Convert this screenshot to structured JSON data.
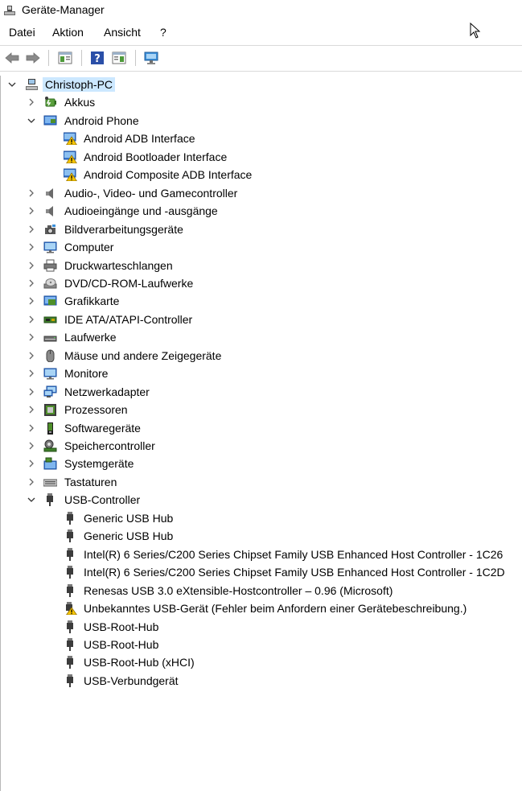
{
  "window": {
    "title": "Geräte-Manager"
  },
  "menu": [
    "Datei",
    "Aktion",
    "Ansicht",
    "?"
  ],
  "toolbar": [
    "back-icon",
    "forward-icon",
    "properties-view-icon",
    "help-icon",
    "action-view-icon",
    "scan-hardware-icon"
  ],
  "tree": {
    "root": "Christoph-PC",
    "items": [
      {
        "label": "Akkus",
        "icon": "battery-icon",
        "expanded": false
      },
      {
        "label": "Android Phone",
        "icon": "android-phone-icon",
        "expanded": true,
        "children": [
          {
            "label": "Android ADB Interface",
            "icon": "warning-device-icon"
          },
          {
            "label": "Android Bootloader Interface",
            "icon": "warning-device-icon"
          },
          {
            "label": "Android Composite ADB Interface",
            "icon": "warning-device-icon"
          }
        ]
      },
      {
        "label": "Audio-, Video- und Gamecontroller",
        "icon": "speaker-icon",
        "expanded": false
      },
      {
        "label": "Audioeingänge und -ausgänge",
        "icon": "speaker-icon",
        "expanded": false
      },
      {
        "label": "Bildverarbeitungsgeräte",
        "icon": "camera-icon",
        "expanded": false
      },
      {
        "label": "Computer",
        "icon": "computer-icon",
        "expanded": false
      },
      {
        "label": "Druckwarteschlangen",
        "icon": "printer-icon",
        "expanded": false
      },
      {
        "label": "DVD/CD-ROM-Laufwerke",
        "icon": "optical-drive-icon",
        "expanded": false
      },
      {
        "label": "Grafikkarte",
        "icon": "display-adapter-icon",
        "expanded": false
      },
      {
        "label": "IDE ATA/ATAPI-Controller",
        "icon": "ide-controller-icon",
        "expanded": false
      },
      {
        "label": "Laufwerke",
        "icon": "disk-drive-icon",
        "expanded": false
      },
      {
        "label": "Mäuse und andere Zeigegeräte",
        "icon": "mouse-icon",
        "expanded": false
      },
      {
        "label": "Monitore",
        "icon": "monitor-icon",
        "expanded": false
      },
      {
        "label": "Netzwerkadapter",
        "icon": "network-adapter-icon",
        "expanded": false
      },
      {
        "label": "Prozessoren",
        "icon": "processor-icon",
        "expanded": false
      },
      {
        "label": "Softwaregeräte",
        "icon": "software-device-icon",
        "expanded": false
      },
      {
        "label": "Speichercontroller",
        "icon": "storage-controller-icon",
        "expanded": false
      },
      {
        "label": "Systemgeräte",
        "icon": "system-device-icon",
        "expanded": false
      },
      {
        "label": "Tastaturen",
        "icon": "keyboard-icon",
        "expanded": false
      },
      {
        "label": "USB-Controller",
        "icon": "usb-icon",
        "expanded": true,
        "children": [
          {
            "label": "Generic USB Hub",
            "icon": "usb-icon"
          },
          {
            "label": "Generic USB Hub",
            "icon": "usb-icon"
          },
          {
            "label": "Intel(R) 6 Series/C200 Series Chipset Family USB Enhanced Host Controller - 1C26",
            "icon": "usb-icon"
          },
          {
            "label": "Intel(R) 6 Series/C200 Series Chipset Family USB Enhanced Host Controller - 1C2D",
            "icon": "usb-icon"
          },
          {
            "label": "Renesas USB 3.0 eXtensible-Hostcontroller – 0.96 (Microsoft)",
            "icon": "usb-icon"
          },
          {
            "label": "Unbekanntes USB-Gerät (Fehler beim Anfordern einer Gerätebeschreibung.)",
            "icon": "usb-warning-icon"
          },
          {
            "label": "USB-Root-Hub",
            "icon": "usb-icon"
          },
          {
            "label": "USB-Root-Hub",
            "icon": "usb-icon"
          },
          {
            "label": "USB-Root-Hub (xHCI)",
            "icon": "usb-icon"
          },
          {
            "label": "USB-Verbundgerät",
            "icon": "usb-icon"
          }
        ]
      }
    ]
  }
}
